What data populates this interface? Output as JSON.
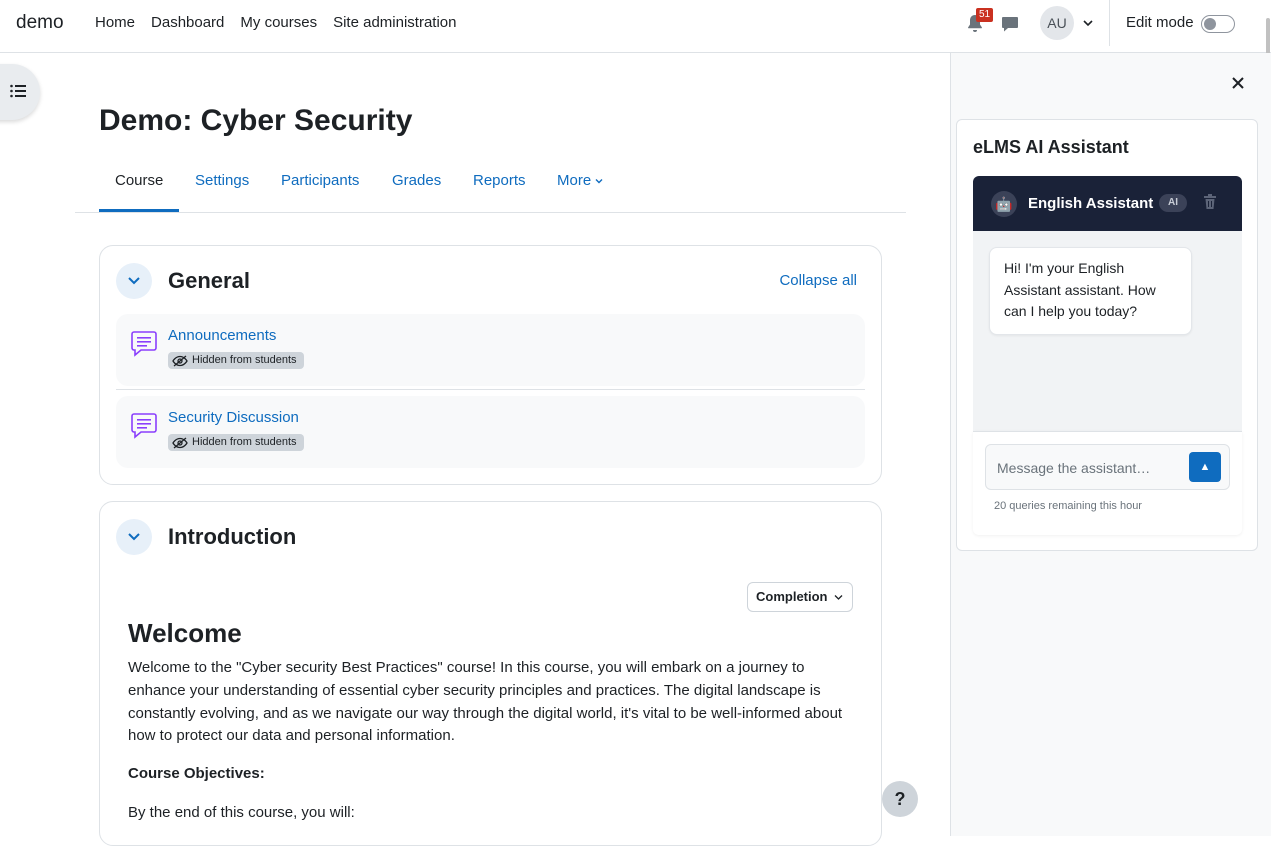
{
  "navbar": {
    "brand": "demo",
    "links": [
      "Home",
      "Dashboard",
      "My courses",
      "Site administration"
    ],
    "notification_count": "51",
    "avatar_initials": "AU",
    "edit_mode_label": "Edit mode",
    "edit_mode_on": false
  },
  "course": {
    "title": "Demo: Cyber Security",
    "tabs": [
      "Course",
      "Settings",
      "Participants",
      "Grades",
      "Reports",
      "More"
    ],
    "active_tab": "Course"
  },
  "sections": {
    "general": {
      "title": "General",
      "collapse_all_label": "Collapse all",
      "activities": [
        {
          "name": "Announcements",
          "badge": "Hidden from students"
        },
        {
          "name": "Security Discussion",
          "badge": "Hidden from students"
        }
      ]
    },
    "introduction": {
      "title": "Introduction",
      "completion_label": "Completion",
      "welcome_heading": "Welcome",
      "welcome_text": "Welcome to the \"Cyber security Best Practices\" course! In this course, you will embark on a journey to enhance your understanding of essential cyber security principles and practices. The digital landscape is constantly evolving, and as we navigate our way through the digital world, it's vital to be well-informed about how to protect our data and personal information.",
      "objectives_title": "Course Objectives:",
      "by_end_text": "By the end of this course, you will:"
    }
  },
  "help_label": "?",
  "assistant": {
    "panel_title": "eLMS AI Assistant",
    "bot_name": "English Assistant",
    "ai_badge": "AI",
    "bot_avatar": "🤖",
    "greeting": "Hi! I'm your English Assistant assistant. How can I help you today?",
    "input_placeholder": "Message the assistant…",
    "send_icon": "▲",
    "queries_remaining": "20 queries remaining this hour"
  },
  "colors": {
    "link": "#0f6cbf",
    "chat_header": "#1a2238",
    "badge_red": "#ca3120",
    "activity_icon": "#8a3ffc"
  }
}
